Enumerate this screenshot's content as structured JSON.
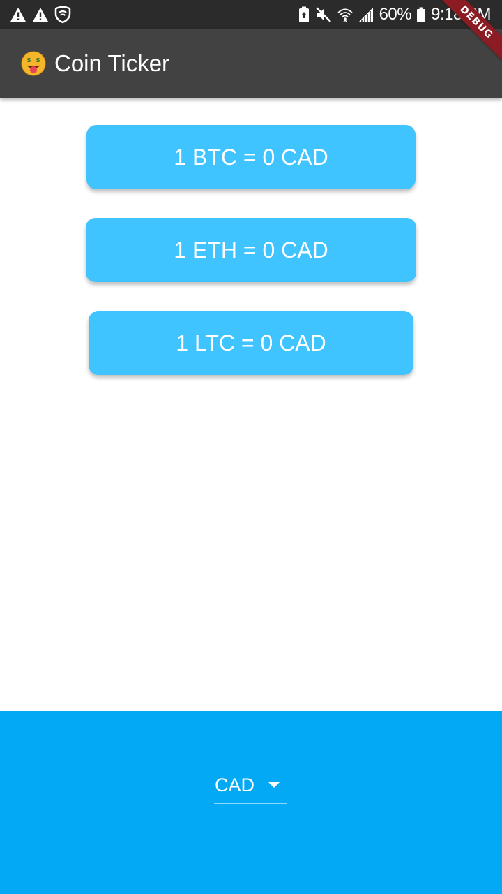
{
  "status_bar": {
    "battery_percent": "60%",
    "time": "9:18 PM",
    "icons": [
      "warning-icon",
      "warning-icon",
      "shield-icon",
      "battery-saver-icon",
      "mute-icon",
      "wifi-icon",
      "signal-icon",
      "battery-icon"
    ]
  },
  "debug_banner": {
    "label": "DEBUG"
  },
  "app_bar": {
    "emoji": "money-mouth-face-icon",
    "title": "Coin Ticker",
    "background": "#424242"
  },
  "tickers": [
    {
      "coin": "BTC",
      "label": "1 BTC = 0 CAD"
    },
    {
      "coin": "ETH",
      "label": "1 ETH = 0 CAD"
    },
    {
      "coin": "LTC",
      "label": "1 LTC = 0 CAD"
    }
  ],
  "currency_picker": {
    "selected": "CAD",
    "background": "#03a9f4"
  },
  "colors": {
    "card": "#40c4ff",
    "accent": "#03a9f4",
    "debug": "#8b1c24"
  }
}
